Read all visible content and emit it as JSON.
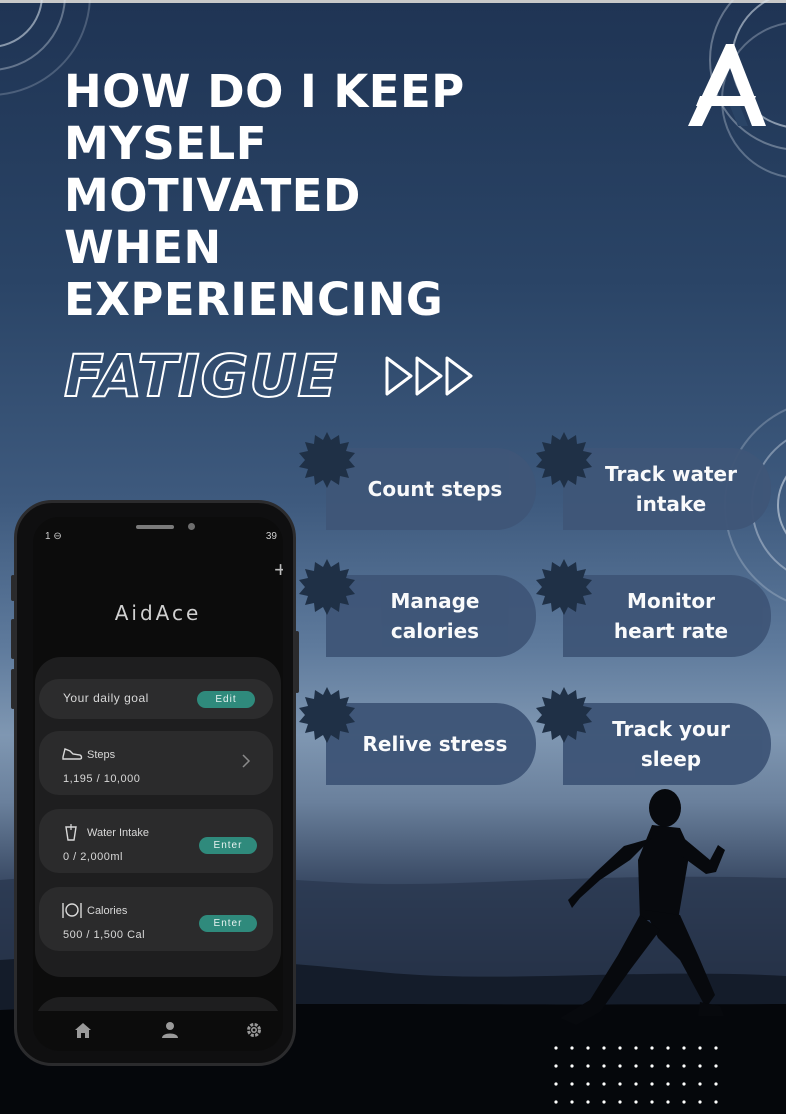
{
  "poster": {
    "title_lines": [
      "HOW DO I KEEP",
      "MYSELF",
      "MOTIVATED",
      "WHEN",
      "EXPERIENCING"
    ],
    "highlight_word": "FATIGUE",
    "logo_icon": "aidace-logo-icon",
    "arrows_icon": "triple-arrow-icon"
  },
  "features": [
    {
      "label": "Count steps"
    },
    {
      "label": "Track water intake"
    },
    {
      "label": "Manage calories"
    },
    {
      "label": "Monitor heart rate"
    },
    {
      "label": "Relive stress"
    },
    {
      "label": "Track your sleep"
    }
  ],
  "phone": {
    "status_left": "1 ⊖",
    "status_right": "39",
    "add_symbol": "+",
    "brand": "AidAce",
    "daily_goal": {
      "label": "Your daily goal",
      "button": "Edit"
    },
    "cards": [
      {
        "name": "Steps",
        "value": "1,195 / 10,000",
        "icon": "shoe-icon",
        "action": "chevron-right-icon"
      },
      {
        "name": "Water Intake",
        "value": "0 / 2,000ml",
        "icon": "water-glass-icon",
        "button": "Enter"
      },
      {
        "name": "Calories",
        "value": "500 / 1,500 Cal",
        "icon": "plate-cutlery-icon",
        "button": "Enter"
      }
    ],
    "nav": [
      "home-icon",
      "profile-icon",
      "settings-icon"
    ]
  },
  "colors": {
    "tile": "#3f5678",
    "badge": "#1f3046",
    "accent_button": "#2f8a7c",
    "text": "#ffffff"
  }
}
